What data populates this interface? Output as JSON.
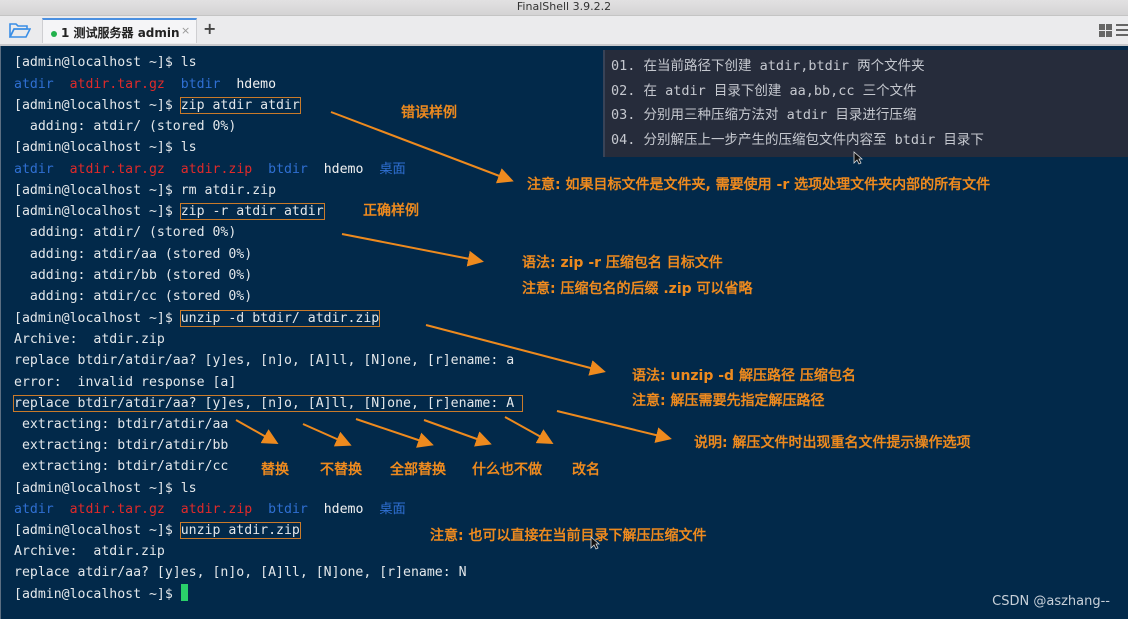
{
  "window": {
    "title": "FinalShell 3.9.2.2"
  },
  "tabbar": {
    "tab_label": "1 测试服务器 admin",
    "close_glyph": "×",
    "add_glyph": "+"
  },
  "terminal": {
    "prompt": "[admin@localhost ~]$ ",
    "lines": [
      {
        "cmd": "ls"
      },
      {
        "ls1": [
          "atdir",
          "atdir.tar.gz",
          "btdir",
          "hdemo"
        ]
      },
      {
        "cmd": "zip atdir atdir"
      },
      {
        "out": "  adding: atdir/ (stored 0%)"
      },
      {
        "cmd": "ls"
      },
      {
        "ls2": [
          "atdir",
          "atdir.tar.gz",
          "atdir.zip",
          "btdir",
          "hdemo",
          "桌面"
        ]
      },
      {
        "cmd": "rm atdir.zip"
      },
      {
        "cmd": "zip -r atdir atdir"
      },
      {
        "out": "  adding: atdir/ (stored 0%)"
      },
      {
        "out": "  adding: atdir/aa (stored 0%)"
      },
      {
        "out": "  adding: atdir/bb (stored 0%)"
      },
      {
        "out": "  adding: atdir/cc (stored 0%)"
      },
      {
        "cmd": "unzip -d btdir/ atdir.zip"
      },
      {
        "out": "Archive:  atdir.zip"
      },
      {
        "out": "replace btdir/atdir/aa? [y]es, [n]o, [A]ll, [N]one, [r]ename: a"
      },
      {
        "out": "error:  invalid response [a]"
      },
      {
        "out": "replace btdir/atdir/aa? [y]es, [n]o, [A]ll, [N]one, [r]ename: A "
      },
      {
        "out": " extracting: btdir/atdir/aa"
      },
      {
        "out": " extracting: btdir/atdir/bb"
      },
      {
        "out": " extracting: btdir/atdir/cc"
      },
      {
        "cmd": "ls"
      },
      {
        "ls3": [
          "atdir",
          "atdir.tar.gz",
          "atdir.zip",
          "btdir",
          "hdemo",
          "桌面"
        ]
      },
      {
        "cmd": "unzip atdir.zip"
      },
      {
        "out": "Archive:  atdir.zip"
      },
      {
        "out": "replace atdir/aa? [y]es, [n]o, [A]ll, [N]one, [r]ename: N"
      },
      {
        "cmd": ""
      }
    ]
  },
  "tasks": [
    "01. 在当前路径下创建 atdir,btdir 两个文件夹",
    "02. 在 atdir 目录下创建 aa,bb,cc 三个文件",
    "03. 分别用三种压缩方法对 atdir 目录进行压缩",
    "04. 分别解压上一步产生的压缩包文件内容至 btdir 目录下"
  ],
  "notes": {
    "wrong_example": "错误样例",
    "note_r_option": "注意: 如果目标文件是文件夹, 需要使用 -r 选项处理文件夹内部的所有文件",
    "right_example": "正确样例",
    "zip_syntax": "语法: zip -r 压缩包名 目标文件",
    "zip_suffix_note": "注意: 压缩包名的后缀 .zip 可以省略",
    "unzip_syntax": "语法: unzip -d 解压路径 压缩包名",
    "unzip_path_note": "注意: 解压需要先指定解压路径",
    "replace_options_note": "说明: 解压文件时出现重名文件提示操作选项",
    "opt_yes": "替换",
    "opt_no": "不替换",
    "opt_all": "全部替换",
    "opt_none": "什么也不做",
    "opt_rename": "改名",
    "unzip_here_note": "注意: 也可以直接在当前目录下解压压缩文件"
  },
  "watermark": "CSDN @aszhang--",
  "colors": {
    "terminal_bg": "#02294a",
    "annotation": "#ee8a1e",
    "dir_blue": "#2f6fd2",
    "archive_red": "#e02a2a",
    "cursor_green": "#2ad06a"
  }
}
